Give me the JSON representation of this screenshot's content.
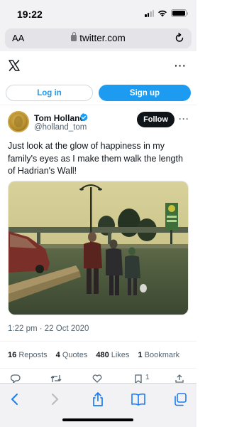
{
  "status_bar": {
    "time": "19:22",
    "signal_icon": "cellular-signal-icon",
    "wifi_icon": "wifi-icon",
    "battery_icon": "battery-icon"
  },
  "browser": {
    "text_size_label": "AA",
    "url": "twitter.com",
    "lock_icon": "lock-icon",
    "reload_icon": "reload-icon"
  },
  "header": {
    "logo": "x-logo-icon",
    "more": "···"
  },
  "auth": {
    "login_label": "Log in",
    "signup_label": "Sign up"
  },
  "tweet": {
    "author_name": "Tom Holland",
    "author_handle": "@holland_tom",
    "verified_icon": "verified-badge-icon",
    "follow_label": "Follow",
    "more": "···",
    "text": "Just look at the glow of happiness in my family's eyes as I make them walk the length of Hadrian's Wall!",
    "timestamp": "1:22 pm · 22 Oct 2020",
    "stats": [
      {
        "count": "16",
        "label": "Reposts"
      },
      {
        "count": "4",
        "label": "Quotes"
      },
      {
        "count": "480",
        "label": "Likes"
      },
      {
        "count": "1",
        "label": "Bookmark"
      }
    ],
    "actions": [
      "reply-icon",
      "repost-icon",
      "like-icon",
      "bookmark-icon",
      "share-icon"
    ],
    "action_counts": {
      "bookmark": "1"
    }
  },
  "toolbar": {
    "items": [
      "back-icon",
      "forward-icon",
      "share-icon",
      "bookmarks-icon",
      "tabs-icon"
    ]
  },
  "colors": {
    "accent": "#1d9bf0",
    "text": "#0f1419",
    "secondary": "#536471",
    "chrome": "#f2f2f4"
  }
}
